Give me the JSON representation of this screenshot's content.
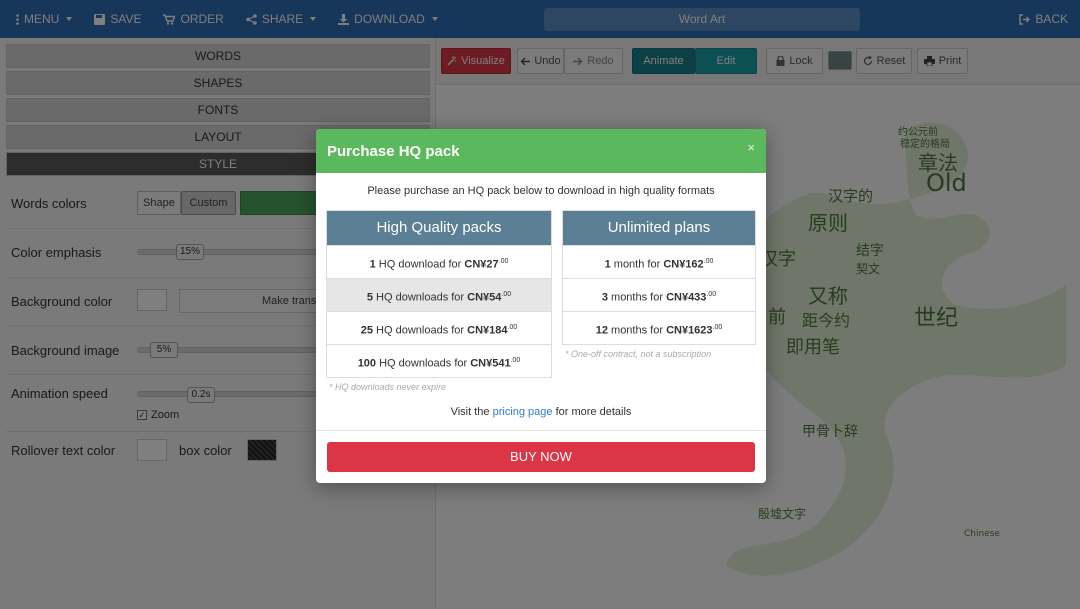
{
  "navbar": {
    "menu": "MENU",
    "save": "SAVE",
    "order": "ORDER",
    "share": "SHARE",
    "download": "DOWNLOAD",
    "title": "Word Art",
    "back": "BACK"
  },
  "sidebar": {
    "tabs": [
      "WORDS",
      "SHAPES",
      "FONTS",
      "LAYOUT",
      "STYLE"
    ],
    "active_tab": "STYLE",
    "words_colors": {
      "label": "Words colors",
      "shape_btn": "Shape",
      "custom_btn": "Custom"
    },
    "color_emphasis": {
      "label": "Color emphasis",
      "value": "15%"
    },
    "background_color": {
      "label": "Background color",
      "button": "Make transparent"
    },
    "background_image": {
      "label": "Background image",
      "value": "5%"
    },
    "animation_speed": {
      "label": "Animation speed",
      "value": "0.2s",
      "zoom_label": "Zoom",
      "zoom_checked": "✓"
    },
    "rollover": {
      "label": "Rollover text color",
      "box_label": "box color"
    }
  },
  "toolbar": {
    "visualize": "Visualize",
    "undo": "Undo",
    "redo": "Redo",
    "animate": "Animate",
    "edit": "Edit",
    "lock": "Lock",
    "reset": "Reset",
    "print": "Print"
  },
  "cloud_words": [
    "约公元前",
    "稳定的格局",
    "章法",
    "Old",
    "汉字的",
    "原则",
    "结字",
    "契文",
    "又称",
    "世纪",
    "距今约",
    "即用笔",
    "甲骨卜辞",
    "殷墟文字",
    "Chinese",
    "前",
    "汉字"
  ],
  "modal": {
    "title": "Purchase HQ pack",
    "close": "×",
    "intro": "Please purchase an HQ pack below to download in high quality formats",
    "hq": {
      "title": "High Quality packs",
      "rows": [
        {
          "count": "1",
          "text": "HQ download for",
          "price": "CN¥27",
          "cents": ".00"
        },
        {
          "count": "5",
          "text": "HQ downloads for",
          "price": "CN¥54",
          "cents": ".00"
        },
        {
          "count": "25",
          "text": "HQ downloads for",
          "price": "CN¥184",
          "cents": ".00"
        },
        {
          "count": "100",
          "text": "HQ downloads for",
          "price": "CN¥541",
          "cents": ".00"
        }
      ],
      "note": "* HQ downloads never expire"
    },
    "unlimited": {
      "title": "Unlimited plans",
      "rows": [
        {
          "count": "1",
          "text": "month for",
          "price": "CN¥162",
          "cents": ".00"
        },
        {
          "count": "3",
          "text": "months for",
          "price": "CN¥433",
          "cents": ".00"
        },
        {
          "count": "12",
          "text": "months for",
          "price": "CN¥1623",
          "cents": ".00"
        }
      ],
      "note": "* One-off contract, not a subscription"
    },
    "details_pre": "Visit the",
    "details_link": "pricing page",
    "details_post": "for more details",
    "buy": "BUY NOW"
  }
}
